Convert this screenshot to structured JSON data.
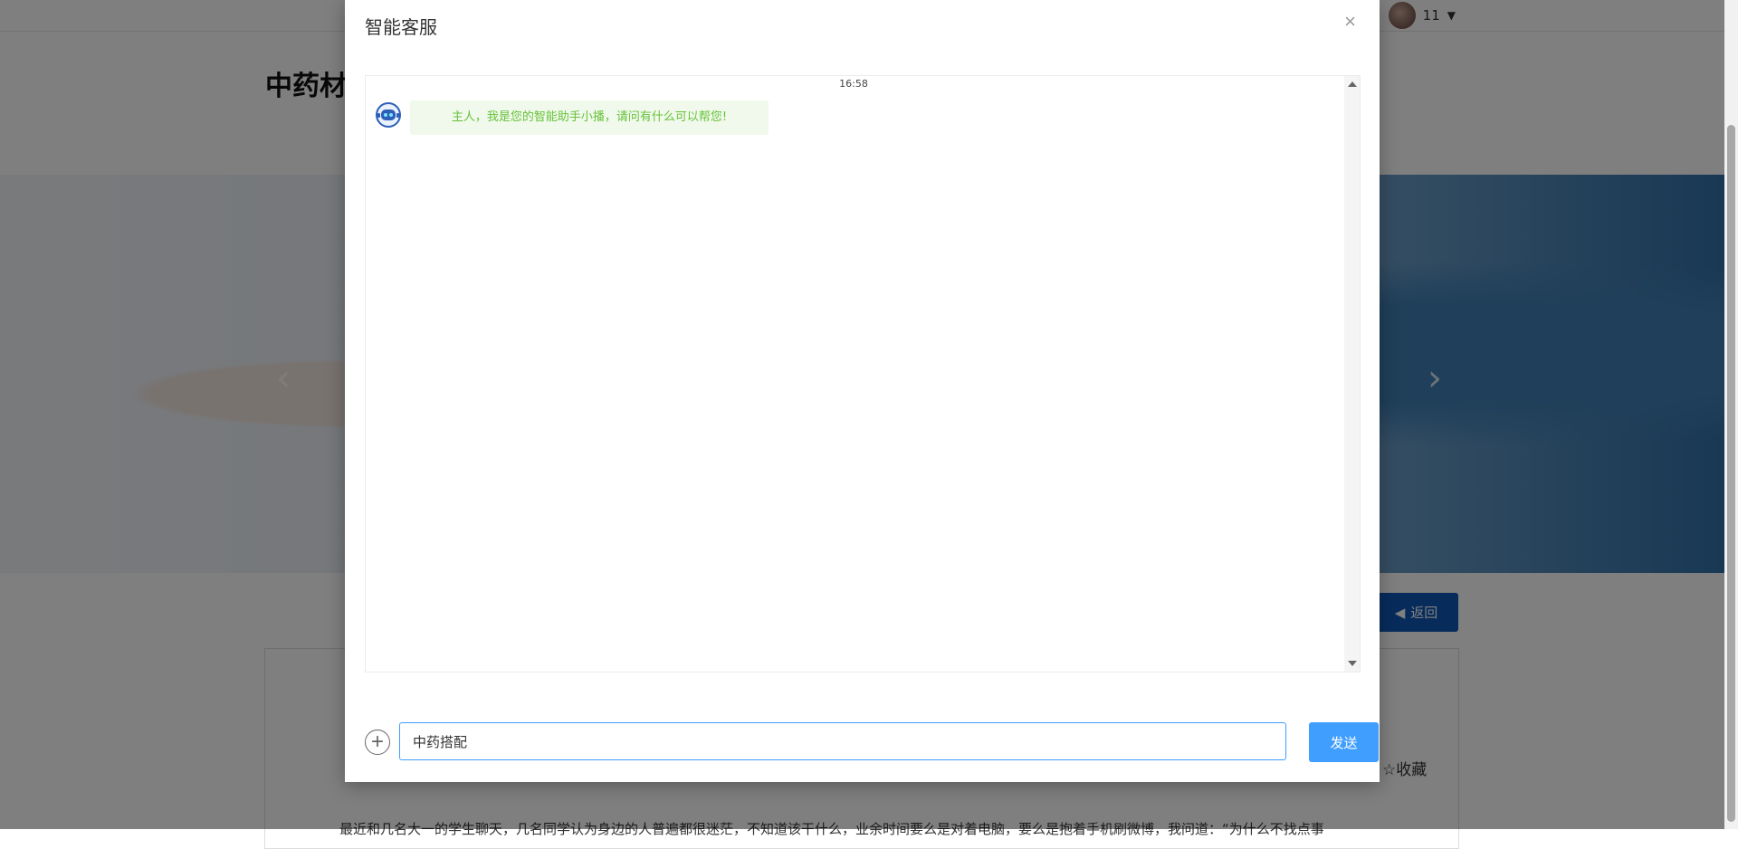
{
  "header": {
    "user_name": "11",
    "caret": "▼"
  },
  "page": {
    "title": "中药材",
    "back_label": "返回",
    "favorite_label": "☆收藏",
    "article_snippet": "最近和几名大一的学生聊天，几名同学认为身边的人普遍都很迷茫，不知道该干什么，业余时间要么是对着电脑，要么是抱着手机刷微博，我问道：“为什么不找点事"
  },
  "modal": {
    "title": "智能客服",
    "close": "×",
    "messages": [
      {
        "time": "16:58",
        "from": "bot",
        "text": "主人，我是您的智能助手小播，请问有什么可以帮您!"
      }
    ],
    "input_value": "中药搭配",
    "send_label": "发送",
    "add_symbol": "+"
  },
  "colors": {
    "accent": "#409eff",
    "back_button": "#0e58b8",
    "bot_bubble_bg": "#f0f9eb",
    "bot_bubble_text": "#67c23a"
  },
  "icons": {
    "bot_avatar": "robot-icon",
    "add": "plus-circle-icon",
    "back": "caret-left-icon",
    "close": "close-icon",
    "carousel_prev": "chevron-left-icon",
    "carousel_next": "chevron-right-icon"
  }
}
